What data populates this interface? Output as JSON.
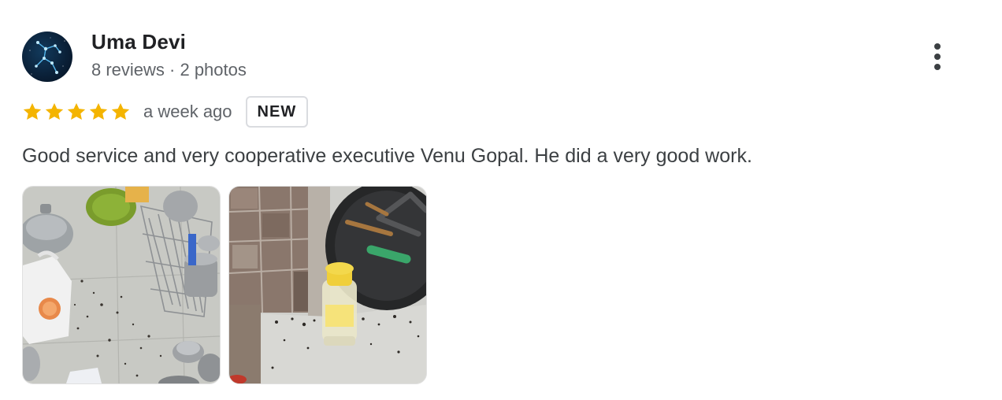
{
  "reviewer": {
    "name": "Uma Devi",
    "meta": "8 reviews · 2 photos",
    "avatar_icon": "constellation-avatar"
  },
  "rating": {
    "stars": 5,
    "max_stars": 5,
    "star_color": "#f4b400",
    "date": "a week ago",
    "badge": "NEW"
  },
  "review": {
    "text": "Good service and very cooperative executive Venu Gopal. He did a very good work."
  },
  "photos": [
    {
      "icon": "kitchen-dish-rack-photo"
    },
    {
      "icon": "kitchen-stove-corner-photo"
    }
  ],
  "actions": {
    "more_icon": "more-vert-icon"
  }
}
